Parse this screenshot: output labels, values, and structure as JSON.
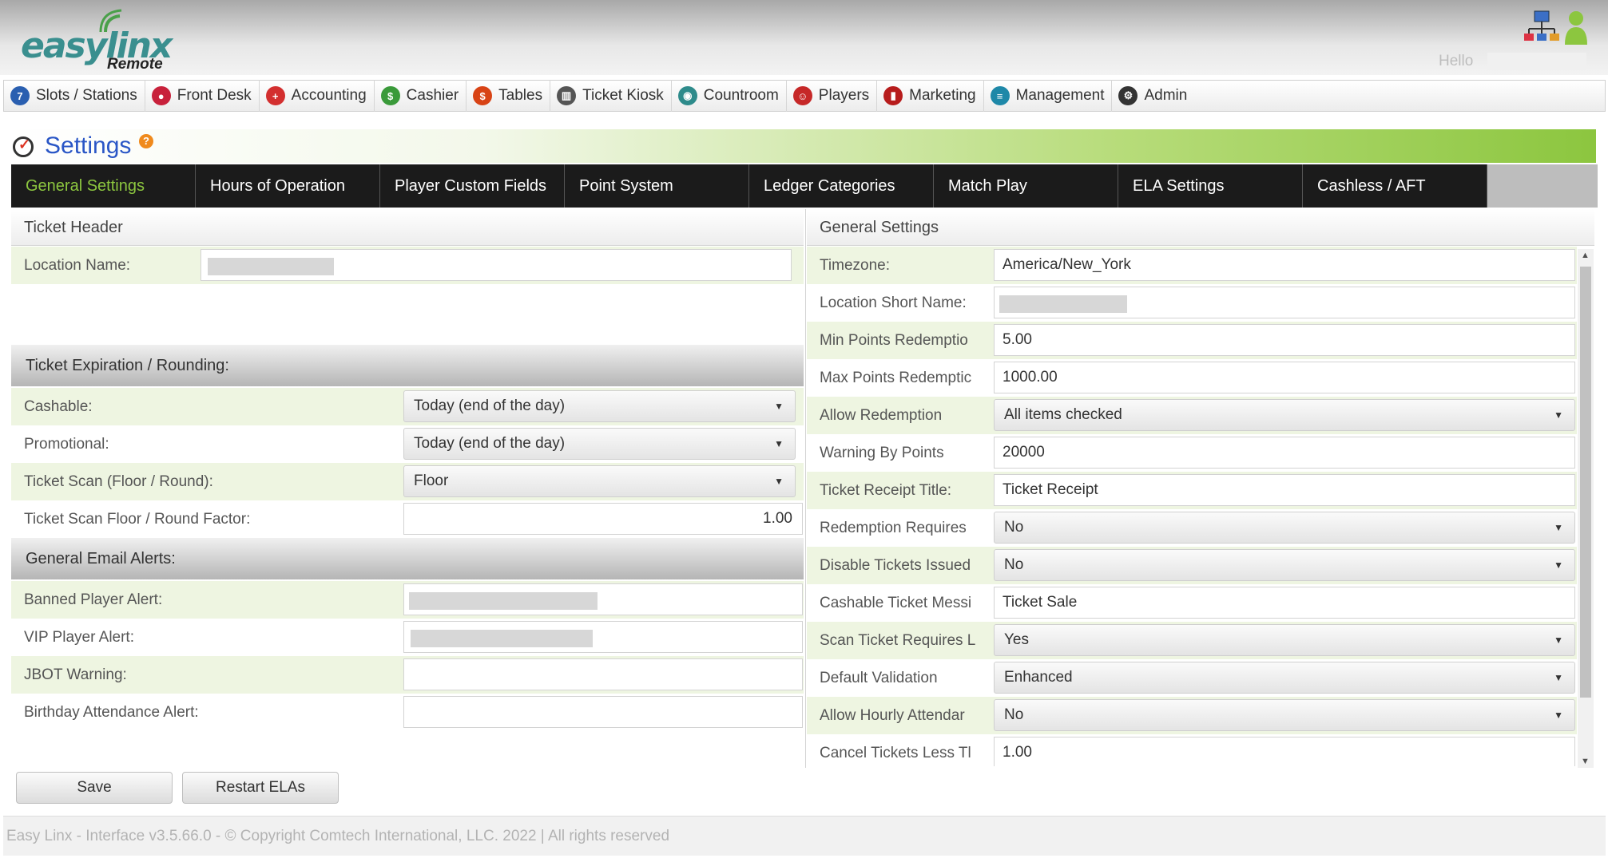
{
  "header": {
    "logo_text": "easylinx",
    "logo_sub": "Remote",
    "greeting": "Hello"
  },
  "nav": [
    {
      "label": "Slots / Stations",
      "icon": "slots-icon",
      "color": "#2a5fb0"
    },
    {
      "label": "Front Desk",
      "icon": "front-desk-icon",
      "color": "#c8213b"
    },
    {
      "label": "Accounting",
      "icon": "accounting-icon",
      "color": "#d32f2f"
    },
    {
      "label": "Cashier",
      "icon": "cashier-icon",
      "color": "#3a9a3a"
    },
    {
      "label": "Tables",
      "icon": "tables-icon",
      "color": "#d84315"
    },
    {
      "label": "Ticket Kiosk",
      "icon": "ticket-kiosk-icon",
      "color": "#555555"
    },
    {
      "label": "Countroom",
      "icon": "countroom-icon",
      "color": "#2e8b8b"
    },
    {
      "label": "Players",
      "icon": "players-icon",
      "color": "#c62828"
    },
    {
      "label": "Marketing",
      "icon": "marketing-icon",
      "color": "#b71c1c"
    },
    {
      "label": "Management",
      "icon": "management-icon",
      "color": "#1e88a8"
    },
    {
      "label": "Admin",
      "icon": "admin-icon",
      "color": "#333333"
    }
  ],
  "page": {
    "title": "Settings",
    "help": "?"
  },
  "tabs": [
    {
      "label": "General Settings",
      "active": true
    },
    {
      "label": "Hours of Operation"
    },
    {
      "label": "Player Custom Fields"
    },
    {
      "label": "Point System"
    },
    {
      "label": "Ledger Categories"
    },
    {
      "label": "Match Play"
    },
    {
      "label": "ELA Settings"
    },
    {
      "label": "Cashless / AFT"
    }
  ],
  "left": {
    "ticket_header_title": "Ticket Header",
    "location_name_label": "Location Name:",
    "expiration_title": "Ticket Expiration / Rounding:",
    "cashable_label": "Cashable:",
    "cashable_value": "Today (end of the day)",
    "promotional_label": "Promotional:",
    "promotional_value": "Today (end of the day)",
    "scan_label": "Ticket Scan (Floor / Round):",
    "scan_value": "Floor",
    "factor_label": "Ticket Scan Floor / Round Factor:",
    "factor_value": "1.00",
    "email_title": "General Email Alerts:",
    "banned_label": "Banned Player Alert:",
    "vip_label": "VIP Player Alert:",
    "jbot_label": "JBOT Warning:",
    "birthday_label": "Birthday Attendance Alert:"
  },
  "right": {
    "title": "General Settings",
    "timezone_label": "Timezone:",
    "timezone_value": "America/New_York",
    "short_name_label": "Location Short Name:",
    "min_points_label": "Min Points Redemptio",
    "min_points_value": "5.00",
    "max_points_label": "Max Points Redemptic",
    "max_points_value": "1000.00",
    "allow_redemption_label": "Allow Redemption",
    "allow_redemption_value": "All items checked",
    "warning_points_label": "Warning By Points",
    "warning_points_value": "20000",
    "receipt_title_label": "Ticket Receipt Title:",
    "receipt_title_value": "Ticket Receipt",
    "redemption_requires_label": "Redemption Requires",
    "redemption_requires_value": "No",
    "disable_tickets_label": "Disable Tickets Issued",
    "disable_tickets_value": "No",
    "cashable_msg_label": "Cashable Ticket Messi",
    "cashable_msg_value": "Ticket Sale",
    "scan_requires_label": "Scan Ticket Requires L",
    "scan_requires_value": "Yes",
    "default_validation_label": "Default Validation",
    "default_validation_value": "Enhanced",
    "hourly_label": "Allow Hourly Attendar",
    "hourly_value": "No",
    "cancel_label": "Cancel Tickets Less Tl",
    "cancel_value": "1.00"
  },
  "buttons": {
    "save": "Save",
    "restart": "Restart ELAs"
  },
  "footer": "Easy Linx - Interface v3.5.66.0 - © Copyright Comtech International, LLC. 2022 | All rights reserved"
}
